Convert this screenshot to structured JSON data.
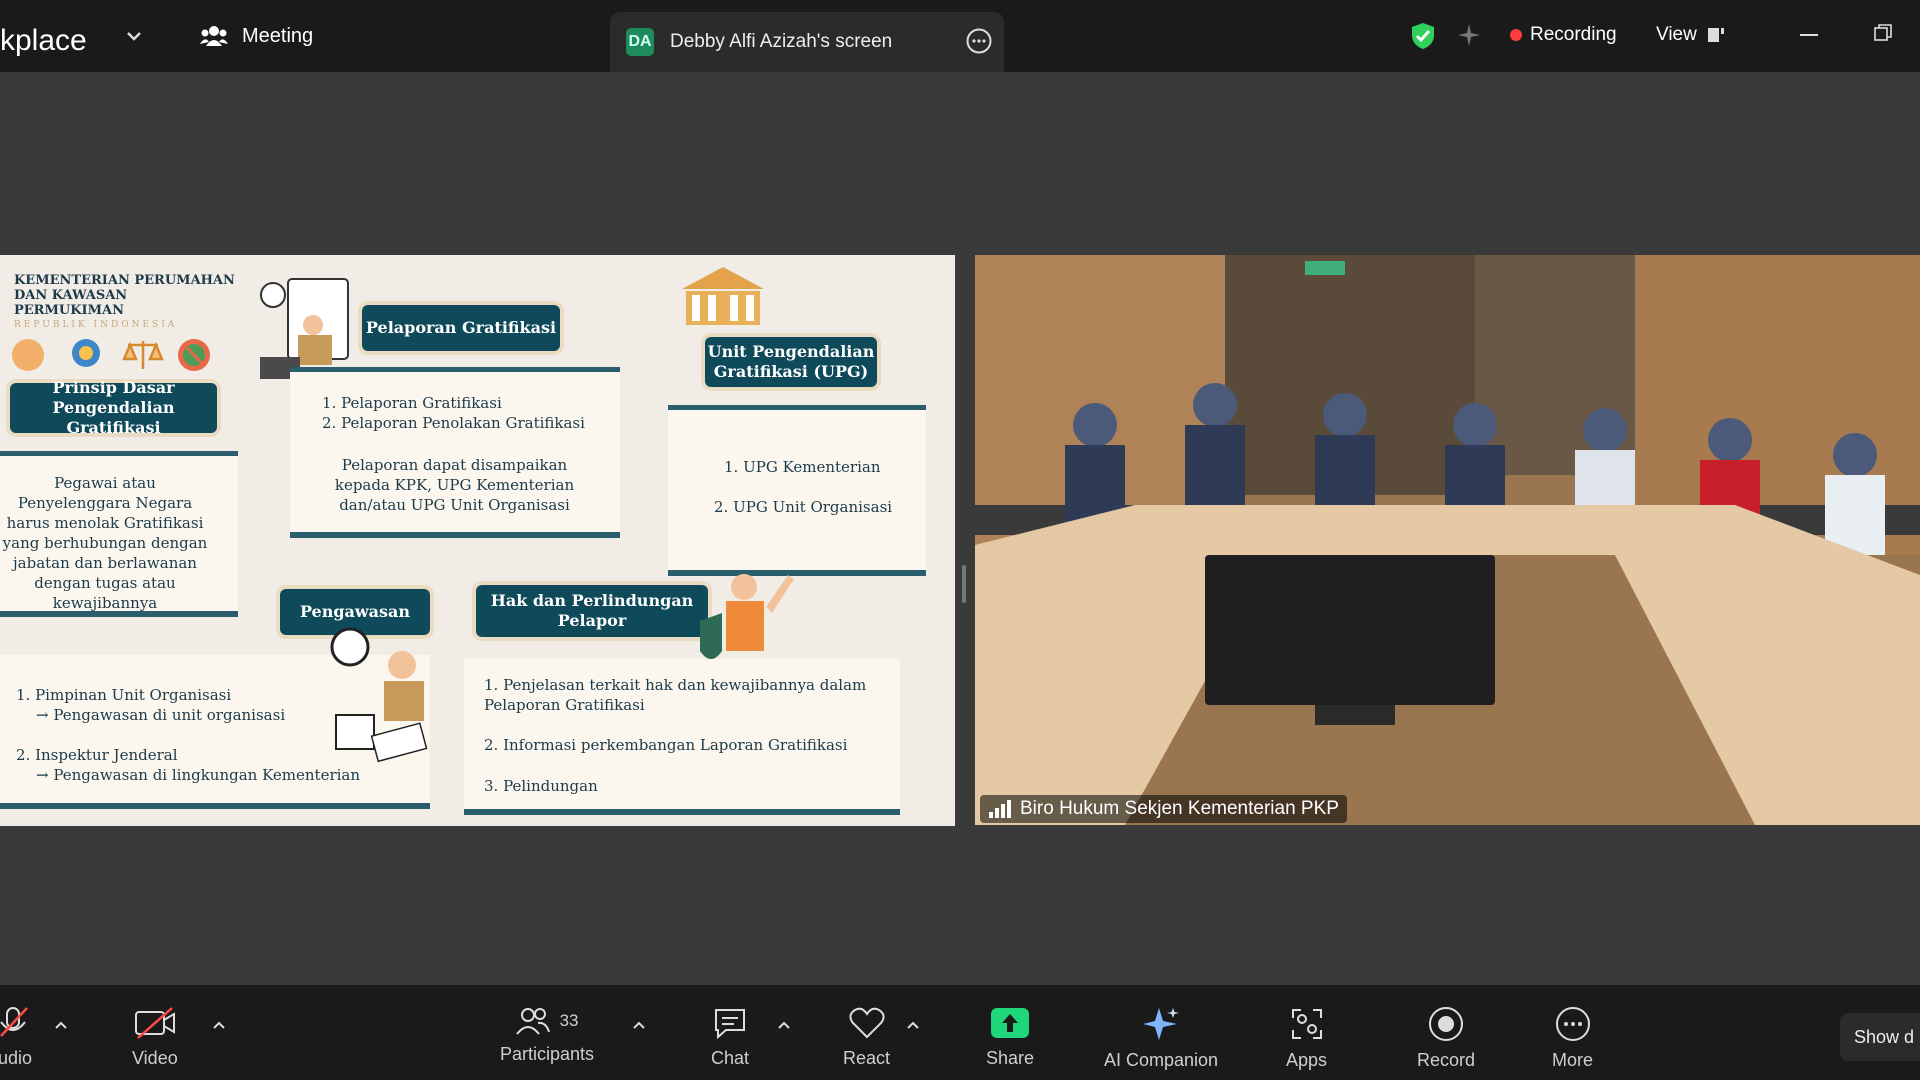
{
  "topbar": {
    "app_title": "kplace",
    "meeting_label": "Meeting",
    "screen_badge": "DA",
    "screen_name": "Debby Alfi Azizah's screen",
    "recording_label": "Recording",
    "view_label": "View"
  },
  "slide": {
    "ministry": "KEMENTERIAN PERUMAHAN DAN KAWASAN PERMUKIMAN",
    "ministry_sub": "REPUBLIK INDONESIA",
    "prinsip_header": "Prinsip Dasar Pengendalian Gratifikasi",
    "prinsip_text": "Pegawai atau Penyelenggara Negara harus menolak Gratifikasi yang berhubungan dengan jabatan dan berlawanan dengan tugas atau kewajibannya",
    "pelaporan_header": "Pelaporan Gratifikasi",
    "pelaporan_item1": "1.    Pelaporan Gratifikasi",
    "pelaporan_item2": "2.    Pelaporan Penolakan Gratifikasi",
    "pelaporan_note": "Pelaporan dapat disampaikan kepada KPK, UPG Kementerian dan/atau UPG Unit Organisasi",
    "upg_header": "Unit Pengendalian Gratifikasi (UPG)",
    "upg_item1": "1. UPG Kementerian",
    "upg_item2": "2. UPG Unit Organisasi",
    "pengawasan_header": "Pengawasan",
    "pengawasan_item1": "1. Pimpinan Unit Organisasi",
    "pengawasan_item1_sub": "→ Pengawasan di unit organisasi",
    "pengawasan_item2": "2. Inspektur Jenderal",
    "pengawasan_item2_sub": "→ Pengawasan di lingkungan Kementerian",
    "hak_header": "Hak dan Perlindungan Pelapor",
    "hak_item1": "1. Penjelasan terkait hak dan kewajibannya dalam Pelaporan Gratifikasi",
    "hak_item2": "2. Informasi perkembangan Laporan Gratifikasi",
    "hak_item3": "3. Pelindungan"
  },
  "video": {
    "participant_name": "Biro Hukum Sekjen Kementerian PKP"
  },
  "toolbar": {
    "audio_label": "udio",
    "video_label": "Video",
    "participants_label": "Participants",
    "participants_count": "33",
    "chat_label": "Chat",
    "react_label": "React",
    "share_label": "Share",
    "ai_label": "AI Companion",
    "apps_label": "Apps",
    "record_label": "Record",
    "more_label": "More",
    "show_label": "Show d"
  },
  "colors": {
    "share_green": "#1fd67a",
    "recording_red": "#ff3b3b",
    "shield_green": "#2fd15a",
    "slide_teal": "#0f4a5a"
  }
}
